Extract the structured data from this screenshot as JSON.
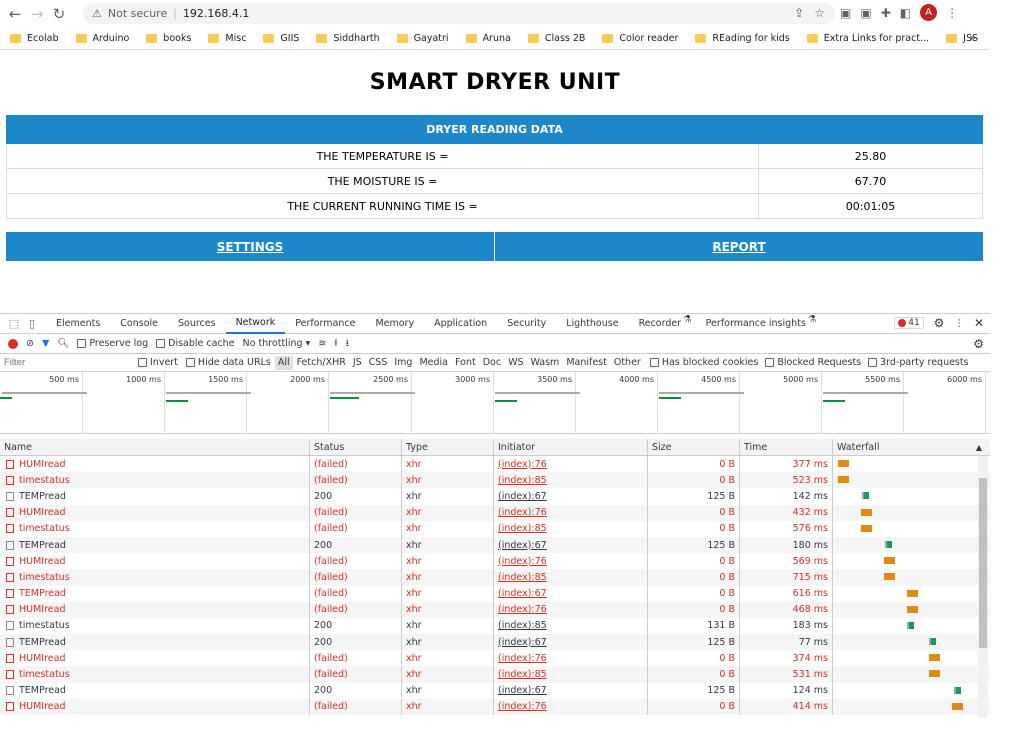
{
  "browser": {
    "security_label": "Not secure",
    "url": "192.168.4.1",
    "avatar_letter": "A",
    "bookmarks": [
      "Ecolab",
      "Arduino",
      "books",
      "Misc",
      "GIIS",
      "Siddharth",
      "Gayatri",
      "Aruna",
      "Class 2B",
      "Color reader",
      "REading for kids",
      "Extra Links for pract...",
      "JSS"
    ],
    "bookmarks_more": "»"
  },
  "page": {
    "title": "SMART DRYER UNIT",
    "table_header": "DRYER READING DATA",
    "rows": [
      {
        "label": "THE TEMPERATURE IS =",
        "value": "25.80"
      },
      {
        "label": "THE MOISTURE IS =",
        "value": "67.70"
      },
      {
        "label": "THE CURRENT RUNNING TIME IS =",
        "value": "00:01:05"
      }
    ],
    "nav": {
      "settings": "SETTINGS",
      "report": "REPORT"
    }
  },
  "devtools": {
    "tabs": [
      "Elements",
      "Console",
      "Sources",
      "Network",
      "Performance",
      "Memory",
      "Application",
      "Security",
      "Lighthouse",
      "Recorder",
      "Performance insights"
    ],
    "active_tab": "Network",
    "error_count": "41",
    "toolbar": {
      "preserve_log": "Preserve log",
      "disable_cache": "Disable cache",
      "throttling": "No throttling"
    },
    "filter": {
      "placeholder": "Filter",
      "invert": "Invert",
      "hide_data_urls": "Hide data URLs",
      "types": [
        "All",
        "Fetch/XHR",
        "JS",
        "CSS",
        "Img",
        "Media",
        "Font",
        "Doc",
        "WS",
        "Wasm",
        "Manifest",
        "Other"
      ],
      "has_blocked_cookies": "Has blocked cookies",
      "blocked_requests": "Blocked Requests",
      "third_party": "3rd-party requests"
    },
    "overview_ticks": [
      "500 ms",
      "1000 ms",
      "1500 ms",
      "2000 ms",
      "2500 ms",
      "3000 ms",
      "3500 ms",
      "4000 ms",
      "4500 ms",
      "5000 ms",
      "5500 ms",
      "6000 ms"
    ],
    "columns": {
      "name": "Name",
      "status": "Status",
      "type": "Type",
      "initiator": "Initiator",
      "size": "Size",
      "time": "Time",
      "waterfall": "Waterfall"
    },
    "requests": [
      {
        "name": "HUMIread",
        "status": "(failed)",
        "type": "xhr",
        "initiator": "(index):76",
        "size": "0 B",
        "time": "377 ms",
        "failed": true,
        "wf": 0.02
      },
      {
        "name": "timestatus",
        "status": "(failed)",
        "type": "xhr",
        "initiator": "(index):85",
        "size": "0 B",
        "time": "523 ms",
        "failed": true,
        "wf": 0.02
      },
      {
        "name": "TEMPread",
        "status": "200",
        "type": "xhr",
        "initiator": "(index):67",
        "size": "125 B",
        "time": "142 ms",
        "failed": false,
        "wf": 0.19
      },
      {
        "name": "HUMIread",
        "status": "(failed)",
        "type": "xhr",
        "initiator": "(index):76",
        "size": "0 B",
        "time": "432 ms",
        "failed": true,
        "wf": 0.18
      },
      {
        "name": "timestatus",
        "status": "(failed)",
        "type": "xhr",
        "initiator": "(index):85",
        "size": "0 B",
        "time": "576 ms",
        "failed": true,
        "wf": 0.18
      },
      {
        "name": "TEMPread",
        "status": "200",
        "type": "xhr",
        "initiator": "(index):67",
        "size": "125 B",
        "time": "180 ms",
        "failed": false,
        "wf": 0.35
      },
      {
        "name": "HUMIread",
        "status": "(failed)",
        "type": "xhr",
        "initiator": "(index):76",
        "size": "0 B",
        "time": "569 ms",
        "failed": true,
        "wf": 0.34
      },
      {
        "name": "timestatus",
        "status": "(failed)",
        "type": "xhr",
        "initiator": "(index):85",
        "size": "0 B",
        "time": "715 ms",
        "failed": true,
        "wf": 0.34
      },
      {
        "name": "TEMPread",
        "status": "(failed)",
        "type": "xhr",
        "initiator": "(index):67",
        "size": "0 B",
        "time": "616 ms",
        "failed": true,
        "wf": 0.5
      },
      {
        "name": "HUMIread",
        "status": "(failed)",
        "type": "xhr",
        "initiator": "(index):76",
        "size": "0 B",
        "time": "468 ms",
        "failed": true,
        "wf": 0.5
      },
      {
        "name": "timestatus",
        "status": "200",
        "type": "xhr",
        "initiator": "(index):85",
        "size": "131 B",
        "time": "183 ms",
        "failed": false,
        "wf": 0.5
      },
      {
        "name": "TEMPread",
        "status": "200",
        "type": "xhr",
        "initiator": "(index):67",
        "size": "125 B",
        "time": "77 ms",
        "failed": false,
        "wf": 0.66
      },
      {
        "name": "HUMIread",
        "status": "(failed)",
        "type": "xhr",
        "initiator": "(index):76",
        "size": "0 B",
        "time": "374 ms",
        "failed": true,
        "wf": 0.66
      },
      {
        "name": "timestatus",
        "status": "(failed)",
        "type": "xhr",
        "initiator": "(index):85",
        "size": "0 B",
        "time": "531 ms",
        "failed": true,
        "wf": 0.66
      },
      {
        "name": "TEMPread",
        "status": "200",
        "type": "xhr",
        "initiator": "(index):67",
        "size": "125 B",
        "time": "124 ms",
        "failed": false,
        "wf": 0.83
      },
      {
        "name": "HUMIread",
        "status": "(failed)",
        "type": "xhr",
        "initiator": "(index):76",
        "size": "0 B",
        "time": "414 ms",
        "failed": true,
        "wf": 0.82
      }
    ]
  }
}
